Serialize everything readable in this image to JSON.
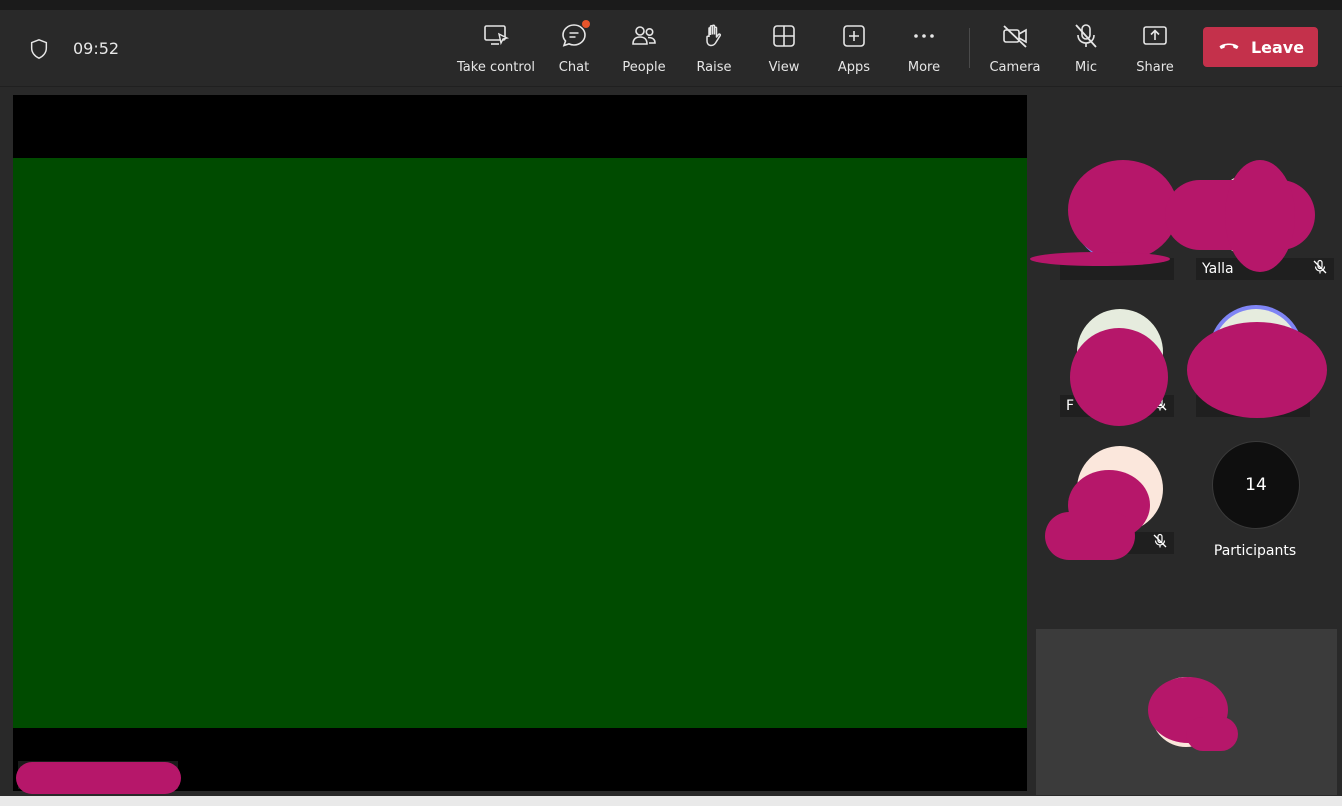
{
  "meeting": {
    "timer": "09:52"
  },
  "toolbar": {
    "take_control": "Take control",
    "chat": "Chat",
    "people": "People",
    "raise": "Raise",
    "view": "View",
    "apps": "Apps",
    "more": "More",
    "camera": "Camera",
    "mic": "Mic",
    "share": "Share",
    "leave": "Leave"
  },
  "participants": {
    "tiles": [
      {
        "name": "",
        "muted": false
      },
      {
        "name": "Yalla",
        "muted": true
      },
      {
        "name": "F",
        "muted": true
      },
      {
        "name": "",
        "muted": false
      },
      {
        "name": "",
        "muted": true
      }
    ],
    "count": "14",
    "count_label": "Participants"
  },
  "colors": {
    "leave": "#c4314b",
    "share_screen": "#004b00",
    "redaction": "#b6176a",
    "chat_badge": "#e8552b",
    "speaker_ring": "#7f85f5"
  },
  "icons": [
    "shield-icon",
    "take-control-icon",
    "chat-icon",
    "people-icon",
    "raise-hand-icon",
    "view-icon",
    "apps-icon",
    "more-icon",
    "camera-off-icon",
    "mic-off-icon",
    "share-icon",
    "hang-up-icon"
  ]
}
